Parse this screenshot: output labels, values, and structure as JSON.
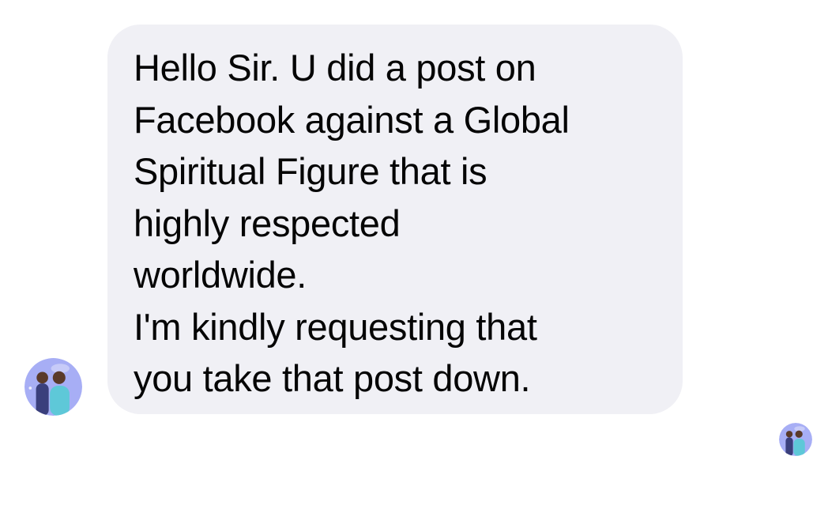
{
  "colors": {
    "page_background": "#ffffff",
    "bubble_background": "#f0f0f5",
    "message_text": "#050505",
    "avatar_background": "#a7aef5",
    "avatar_figure_left": "#3a3f7c",
    "avatar_figure_right": "#5ec8d8",
    "avatar_skin": "#5a3a2a"
  },
  "conversation": {
    "incoming_message": {
      "lines": [
        "Hello Sir. U did a post on",
        "Facebook against a Global",
        "Spiritual Figure that is",
        "highly respected",
        "worldwide.",
        "I'm kindly requesting that",
        "you take that post down."
      ]
    },
    "sender_avatar": {
      "icon": "profile-photo-avatar"
    },
    "read_receipt": {
      "icon": "read-receipt-avatar"
    }
  }
}
